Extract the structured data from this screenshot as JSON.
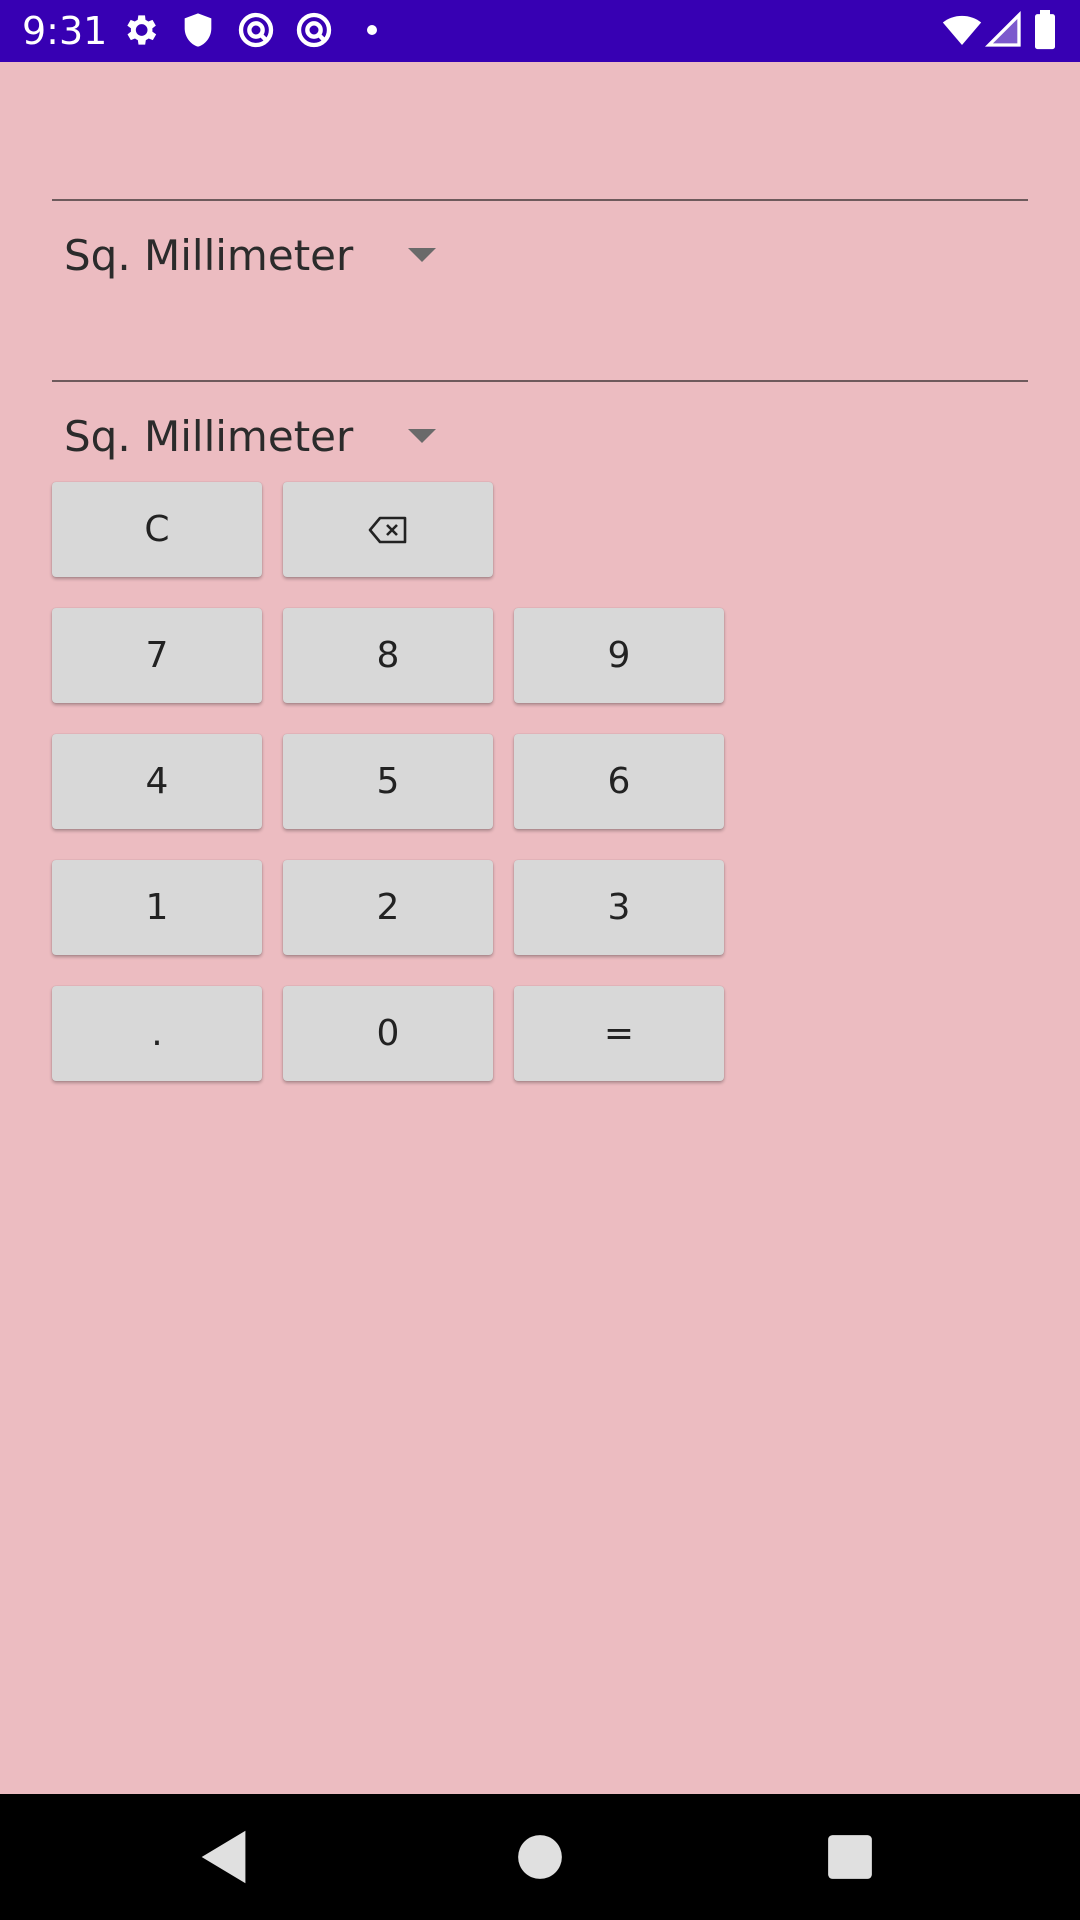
{
  "status_bar": {
    "time": "9:31",
    "icons": [
      "gear-icon",
      "shield-icon",
      "at-sign-icon",
      "at-sign-icon",
      "dot-icon",
      "wifi-icon",
      "signal-icon",
      "battery-icon"
    ],
    "color": "#3700b3"
  },
  "converter": {
    "input": {
      "value": "",
      "unit": "Sq. Millimeter"
    },
    "output": {
      "value": "",
      "unit": "Sq. Millimeter"
    }
  },
  "keypad": {
    "clear": "C",
    "backspace_icon": "backspace-icon",
    "seven": "7",
    "eight": "8",
    "nine": "9",
    "four": "4",
    "five": "5",
    "six": "6",
    "one": "1",
    "two": "2",
    "three": "3",
    "dot": ".",
    "zero": "0",
    "equals": "="
  },
  "nav_bar": {
    "icons": [
      "back-icon",
      "home-icon",
      "recents-icon"
    ]
  },
  "colors": {
    "background": "#ecbcc1",
    "key": "#d8d8d8",
    "status_bar": "#3700b3",
    "nav_bar": "#000000"
  }
}
